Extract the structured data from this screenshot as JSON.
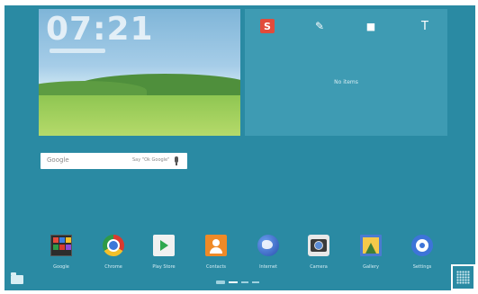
{
  "clock": {
    "time": "07:21"
  },
  "memo": {
    "tools": [
      "s-note-icon",
      "pen-icon",
      "camera-icon",
      "text-icon"
    ],
    "tool_t_glyph": "T",
    "tool_s_glyph": "S",
    "empty_text": "No items"
  },
  "search": {
    "logo": "Google",
    "hint": "Say \"Ok Google\""
  },
  "apps": [
    {
      "label": "Google",
      "icon": "google-folder-icon"
    },
    {
      "label": "Chrome",
      "icon": "chrome-icon"
    },
    {
      "label": "Play Store",
      "icon": "play-store-icon"
    },
    {
      "label": "Contacts",
      "icon": "contacts-icon"
    },
    {
      "label": "Internet",
      "icon": "internet-icon"
    },
    {
      "label": "Camera",
      "icon": "camera-icon"
    },
    {
      "label": "Gallery",
      "icon": "gallery-icon"
    },
    {
      "label": "Settings",
      "icon": "settings-icon"
    }
  ],
  "pages": {
    "count": 3,
    "active": 1
  },
  "colors": {
    "wallpaper": "#2a8aa3",
    "widget": "#3e9bb3",
    "accent_red": "#e24b3b"
  }
}
